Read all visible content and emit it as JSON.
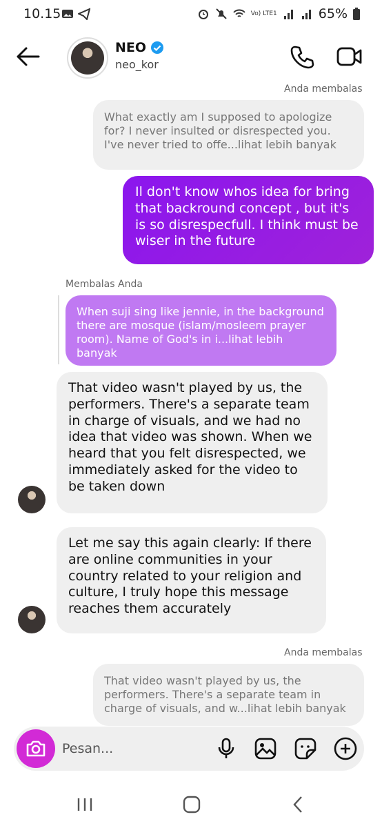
{
  "status_bar": {
    "time": "10.15",
    "battery": "65%",
    "network": "Vo) LTE1"
  },
  "header": {
    "name": "NEO",
    "handle": "neo_kor",
    "verified": true
  },
  "messages": [
    {
      "meta": "Anda membalas",
      "text": "What exactly am I supposed to apologize for? I never insulted or disrespected you. I've never tried to offe...",
      "more": "lihat lebih banyak"
    },
    {
      "text": "Il don't know whos idea for bring that backround concept , but it's is so disrespecfull. I think must be wiser in the future"
    },
    {
      "meta": "Membalas Anda",
      "text": "When suji sing like jennie, in the background there are mosque (islam/mosleem prayer room). Name of God's in i...",
      "more": "lihat lebih banyak"
    },
    {
      "text": "That video wasn't played by us, the performers. There's a separate team in charge of visuals, and we had no idea that video was shown. When we heard that you felt disrespected, we immediately asked for the video to be taken down"
    },
    {
      "text": "Let me say this again clearly: If there are online communities in your country related to your religion and culture, I truly hope this message reaches them accurately"
    },
    {
      "meta": "Anda membalas",
      "text": "That video wasn't played by us, the performers. There's a separate team in charge of visuals, and w...",
      "more": "lihat lebih banyak"
    }
  ],
  "composer": {
    "placeholder": "Pesan..."
  },
  "colors": {
    "accent_purple": "#8b16ee",
    "reply_purple": "#c079f2",
    "camera_magenta": "#d22ad6",
    "bubble_gray": "#efefef",
    "verified_blue": "#1d9bf0"
  },
  "icons": [
    "back-arrow-icon",
    "verified-icon",
    "phone-icon",
    "video-icon",
    "camera-icon",
    "mic-icon",
    "image-icon",
    "sticker-icon",
    "plus-icon",
    "recents-icon",
    "home-icon",
    "nav-back-icon"
  ]
}
